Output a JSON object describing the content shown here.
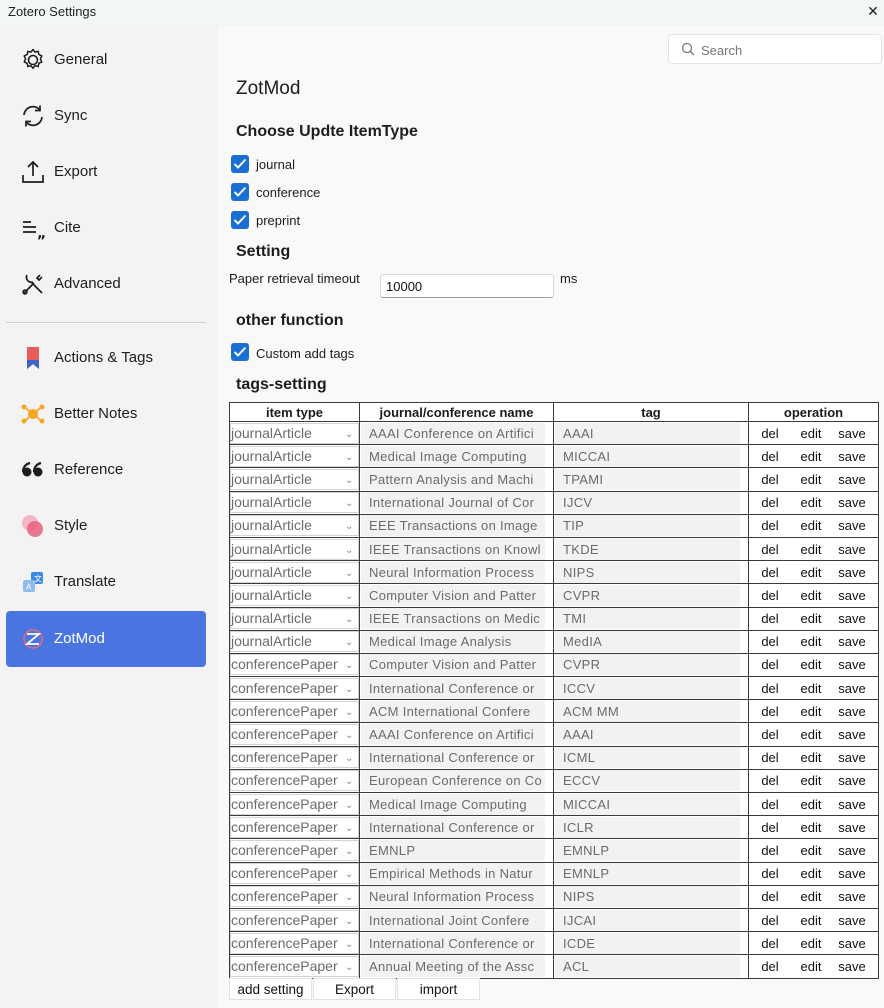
{
  "window": {
    "title": "Zotero Settings",
    "close_glyph": "✕"
  },
  "sidebar": {
    "items": [
      {
        "label": "General",
        "icon": "gear-icon"
      },
      {
        "label": "Sync",
        "icon": "sync-icon"
      },
      {
        "label": "Export",
        "icon": "export-icon"
      },
      {
        "label": "Cite",
        "icon": "cite-icon"
      },
      {
        "label": "Advanced",
        "icon": "tools-icon"
      },
      {
        "label": "Actions & Tags",
        "icon": "bookmark-icon"
      },
      {
        "label": "Better Notes",
        "icon": "better-notes-icon"
      },
      {
        "label": "Reference",
        "icon": "quote-icon"
      },
      {
        "label": "Style",
        "icon": "style-icon"
      },
      {
        "label": "Translate",
        "icon": "translate-icon"
      },
      {
        "label": "ZotMod",
        "icon": "zotmod-icon",
        "active": true
      }
    ]
  },
  "search": {
    "placeholder": "Search"
  },
  "main": {
    "title": "ZotMod",
    "item_type_heading": "Choose Updte ItemType",
    "item_types": [
      {
        "label": "journal",
        "checked": true
      },
      {
        "label": "conference",
        "checked": true
      },
      {
        "label": "preprint",
        "checked": true
      }
    ],
    "setting_heading": "Setting",
    "timeout_label": "Paper retrieval timeout",
    "timeout_value": "10000",
    "timeout_unit": "ms",
    "other_heading": "other function",
    "custom_tags": {
      "label": "Custom add tags",
      "checked": true
    },
    "tags_heading": "tags-setting",
    "table": {
      "headers": [
        "item type",
        "journal/conference name",
        "tag",
        "operation"
      ],
      "op_labels": {
        "del": "del",
        "edit": "edit",
        "save": "save"
      },
      "rows": [
        {
          "type": "journalArticle",
          "name": "AAAI Conference on Artifici",
          "tag": "AAAI"
        },
        {
          "type": "journalArticle",
          "name": "Medical Image Computing",
          "tag": "MICCAI"
        },
        {
          "type": "journalArticle",
          "name": "Pattern Analysis and Machi",
          "tag": "TPAMI"
        },
        {
          "type": "journalArticle",
          "name": "International Journal of Cor",
          "tag": "IJCV"
        },
        {
          "type": "journalArticle",
          "name": "EEE Transactions on Image",
          "tag": "TIP"
        },
        {
          "type": "journalArticle",
          "name": "IEEE Transactions on Knowl",
          "tag": "TKDE"
        },
        {
          "type": "journalArticle",
          "name": "Neural Information Process",
          "tag": "NIPS"
        },
        {
          "type": "journalArticle",
          "name": "Computer Vision and Patter",
          "tag": "CVPR"
        },
        {
          "type": "journalArticle",
          "name": "IEEE Transactions on Medic",
          "tag": "TMI"
        },
        {
          "type": "journalArticle",
          "name": "Medical Image Analysis",
          "tag": "MedIA"
        },
        {
          "type": "conferencePaper",
          "name": "Computer Vision and Patter",
          "tag": "CVPR"
        },
        {
          "type": "conferencePaper",
          "name": "International Conference or",
          "tag": "ICCV"
        },
        {
          "type": "conferencePaper",
          "name": "ACM International Confere",
          "tag": "ACM MM"
        },
        {
          "type": "conferencePaper",
          "name": "AAAI Conference on Artifici",
          "tag": "AAAI"
        },
        {
          "type": "conferencePaper",
          "name": "International Conference or",
          "tag": "ICML"
        },
        {
          "type": "conferencePaper",
          "name": "European Conference on Co",
          "tag": "ECCV"
        },
        {
          "type": "conferencePaper",
          "name": "Medical Image Computing",
          "tag": "MICCAI"
        },
        {
          "type": "conferencePaper",
          "name": "International Conference or",
          "tag": "ICLR"
        },
        {
          "type": "conferencePaper",
          "name": "EMNLP",
          "tag": "EMNLP"
        },
        {
          "type": "conferencePaper",
          "name": "Empirical Methods in Natur",
          "tag": "EMNLP"
        },
        {
          "type": "conferencePaper",
          "name": "Neural Information Process",
          "tag": "NIPS"
        },
        {
          "type": "conferencePaper",
          "name": "International Joint Confere",
          "tag": "IJCAI"
        },
        {
          "type": "conferencePaper",
          "name": "International Conference or",
          "tag": "ICDE"
        },
        {
          "type": "conferencePaper",
          "name": "Annual Meeting of the Assc",
          "tag": "ACL"
        }
      ]
    },
    "buttons": {
      "add": "add setting",
      "export": "Export",
      "import": "import"
    }
  },
  "colors": {
    "accent": "#4a74df",
    "checkbox": "#1a6fd2",
    "sidebar_bg": "#f3f3f3",
    "titlebar_bg": "#f2f7f5"
  }
}
